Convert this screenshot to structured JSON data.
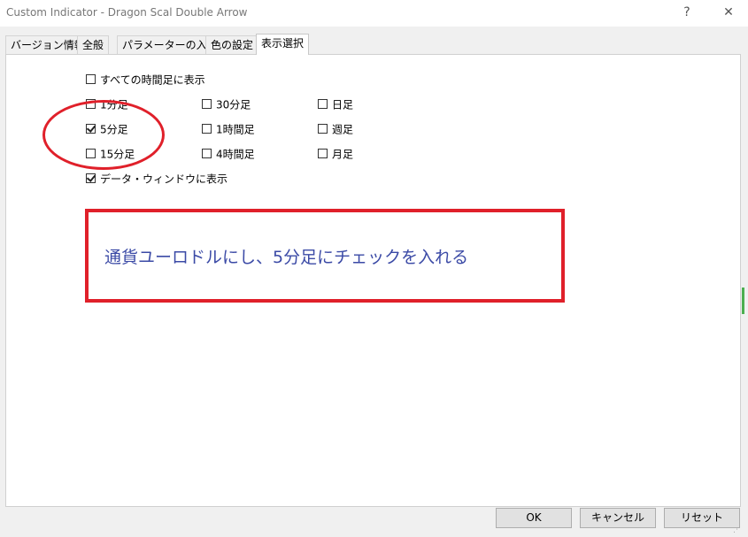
{
  "window": {
    "title": "Custom Indicator - Dragon Scal Double Arrow",
    "help_label": "?",
    "close_label": "✕"
  },
  "tabs": [
    {
      "label": "バージョン情報",
      "active": false
    },
    {
      "label": "全般",
      "active": false
    },
    {
      "label": "パラメーターの入力",
      "active": false
    },
    {
      "label": "色の設定",
      "active": false
    },
    {
      "label": "表示選択",
      "active": true
    }
  ],
  "display": {
    "all_timeframes": {
      "label": "すべての時間足に表示",
      "checked": false
    },
    "timeframes": [
      {
        "label": "1分足",
        "checked": false
      },
      {
        "label": "5分足",
        "checked": true
      },
      {
        "label": "15分足",
        "checked": false
      },
      {
        "label": "30分足",
        "checked": false
      },
      {
        "label": "1時間足",
        "checked": false
      },
      {
        "label": "4時間足",
        "checked": false
      },
      {
        "label": "日足",
        "checked": false
      },
      {
        "label": "週足",
        "checked": false
      },
      {
        "label": "月足",
        "checked": false
      }
    ],
    "data_window": {
      "label": "データ・ウィンドウに表示",
      "checked": true
    }
  },
  "annotation": {
    "text": "通貨ユーロドルにし、5分足にチェックを入れる",
    "color": "#e0202a",
    "text_color": "#3b4aa6"
  },
  "buttons": {
    "ok": "OK",
    "cancel": "キャンセル",
    "reset": "リセット"
  }
}
